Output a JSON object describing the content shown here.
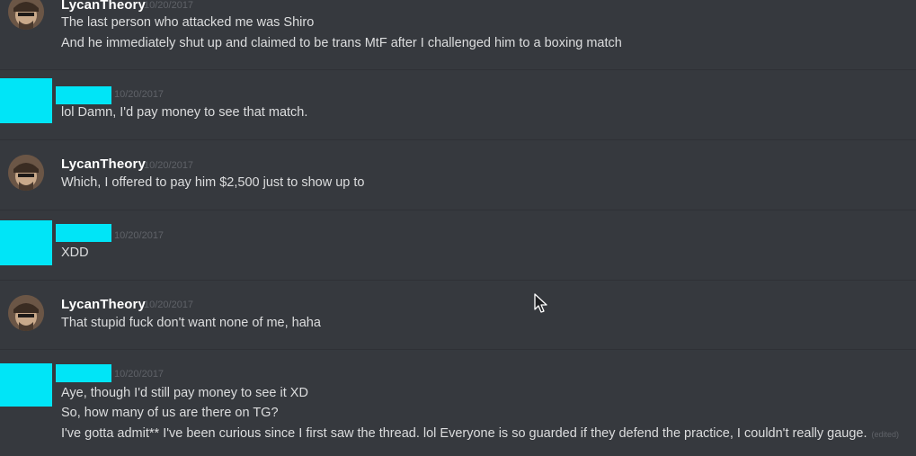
{
  "messages": [
    {
      "author": "LycanTheory",
      "timestamp": "10/20/2017",
      "lines": [
        "The last person who attacked me was Shiro",
        "And he immediately shut up and claimed to be trans MtF after I challenged him to a boxing match"
      ]
    },
    {
      "author": "",
      "timestamp": "10/20/2017",
      "lines": [
        "lol Damn, I'd pay money to see that match."
      ]
    },
    {
      "author": "LycanTheory",
      "timestamp": "10/20/2017",
      "lines": [
        "Which, I offered to pay him $2,500 just to show up to"
      ]
    },
    {
      "author": "",
      "timestamp": "10/20/2017",
      "lines": [
        "XDD"
      ]
    },
    {
      "author": "LycanTheory",
      "timestamp": "10/20/2017",
      "lines": [
        "That stupid fuck don't want none of me, haha"
      ]
    },
    {
      "author": "",
      "timestamp": "10/20/2017",
      "lines": [
        "Aye, though I'd still pay money to see it XD",
        "So, how many of us are there on TG?",
        "I've gotta admit** I've been curious since I first saw the thread. lol Everyone is so guarded if they defend the practice, I couldn't really gauge."
      ],
      "edited_label": "(edited)"
    }
  ],
  "colors": {
    "background": "#36393e",
    "redaction": "#00e5f7",
    "username": "#ffffff",
    "text": "#dcddde",
    "timestamp": "#5f6268"
  },
  "icons": {
    "avatar": "user-avatar",
    "cursor": "mouse-pointer-icon"
  }
}
